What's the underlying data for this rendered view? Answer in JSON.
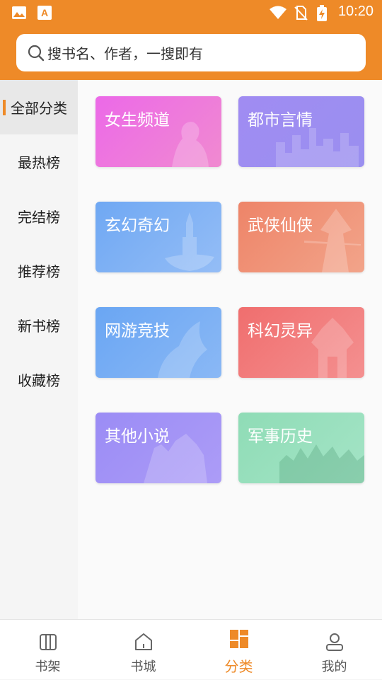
{
  "status_bar": {
    "time": "10:20"
  },
  "search": {
    "placeholder": "搜书名、作者，一搜即有"
  },
  "sidebar": {
    "items": [
      {
        "label": "全部分类",
        "active": true
      },
      {
        "label": "最热榜",
        "active": false
      },
      {
        "label": "完结榜",
        "active": false
      },
      {
        "label": "推荐榜",
        "active": false
      },
      {
        "label": "新书榜",
        "active": false
      },
      {
        "label": "收藏榜",
        "active": false
      }
    ]
  },
  "categories": [
    {
      "label": "女生频道",
      "color": "#e86de6"
    },
    {
      "label": "都市言情",
      "color": "#9d8df2"
    },
    {
      "label": "玄幻奇幻",
      "color": "#7fb2f5"
    },
    {
      "label": "武侠仙侠",
      "color": "#ef9275"
    },
    {
      "label": "网游竞技",
      "color": "#73aaf3"
    },
    {
      "label": "科幻灵异",
      "color": "#f27878"
    },
    {
      "label": "其他小说",
      "color": "#9f8ff6"
    },
    {
      "label": "军事历史",
      "color": "#90dcb8"
    }
  ],
  "tabs": [
    {
      "label": "书架",
      "icon": "bookshelf-icon",
      "active": false
    },
    {
      "label": "书城",
      "icon": "home-icon",
      "active": false
    },
    {
      "label": "分类",
      "icon": "category-grid-icon",
      "active": true
    },
    {
      "label": "我的",
      "icon": "profile-icon",
      "active": false
    }
  ],
  "colors": {
    "accent": "#ee8a28"
  }
}
